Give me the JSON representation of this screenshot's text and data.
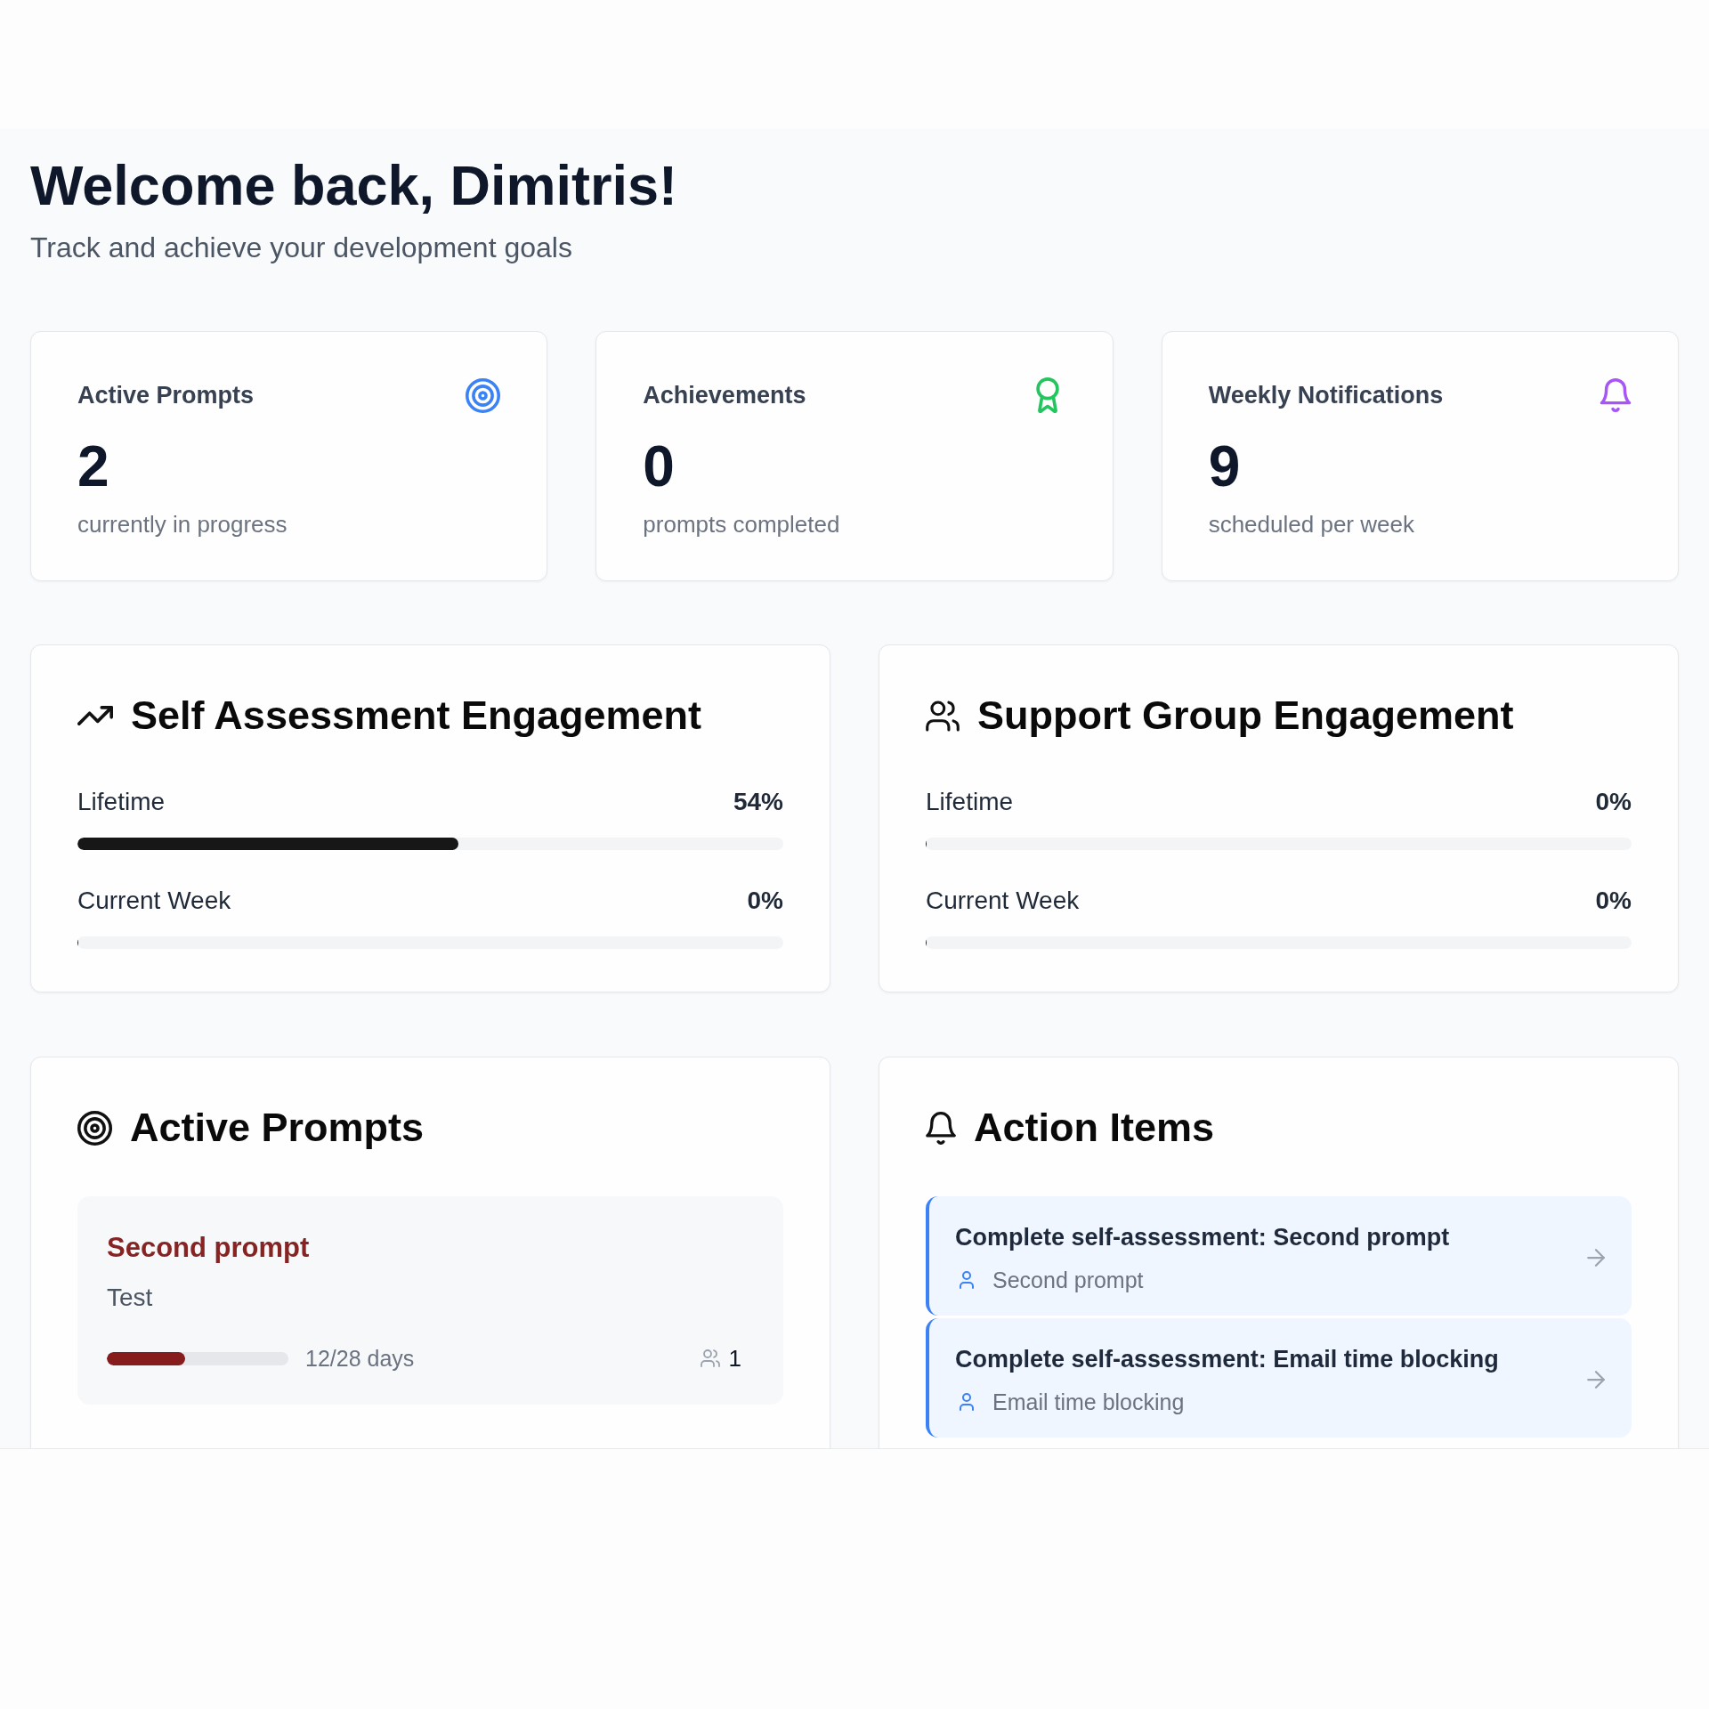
{
  "header": {
    "title": "Welcome back, Dimitris!",
    "subtitle": "Track and achieve your development goals"
  },
  "stats": [
    {
      "label": "Active Prompts",
      "value": "2",
      "caption": "currently in progress",
      "kind": "target",
      "color": "#3b82f6"
    },
    {
      "label": "Achievements",
      "value": "0",
      "caption": "prompts completed",
      "kind": "award",
      "color": "#22c55e"
    },
    {
      "label": "Weekly Notifications",
      "value": "9",
      "caption": "scheduled per week",
      "kind": "bell",
      "color": "#a855f7"
    }
  ],
  "engagement": [
    {
      "title": "Self Assessment Engagement",
      "kind": "trend",
      "metrics": [
        {
          "label": "Lifetime",
          "reading": "54%",
          "level": 0.54
        },
        {
          "label": "Current Week",
          "reading": "0%",
          "level": 0
        }
      ]
    },
    {
      "title": "Support Group Engagement",
      "kind": "group",
      "metrics": [
        {
          "label": "Lifetime",
          "reading": "0%",
          "level": 0
        },
        {
          "label": "Current Week",
          "reading": "0%",
          "level": 0
        }
      ]
    }
  ],
  "active_prompts": {
    "title": "Active Prompts",
    "items": [
      {
        "title": "Second prompt",
        "description": "Test",
        "level": 0.43,
        "days": "12/28 days",
        "members": "1"
      }
    ]
  },
  "action_items": {
    "title": "Action Items",
    "items": [
      {
        "title": "Complete self-assessment: Second prompt",
        "prompt": "Second prompt"
      },
      {
        "title": "Complete self-assessment: Email time blocking",
        "prompt": "Email time blocking"
      }
    ]
  }
}
